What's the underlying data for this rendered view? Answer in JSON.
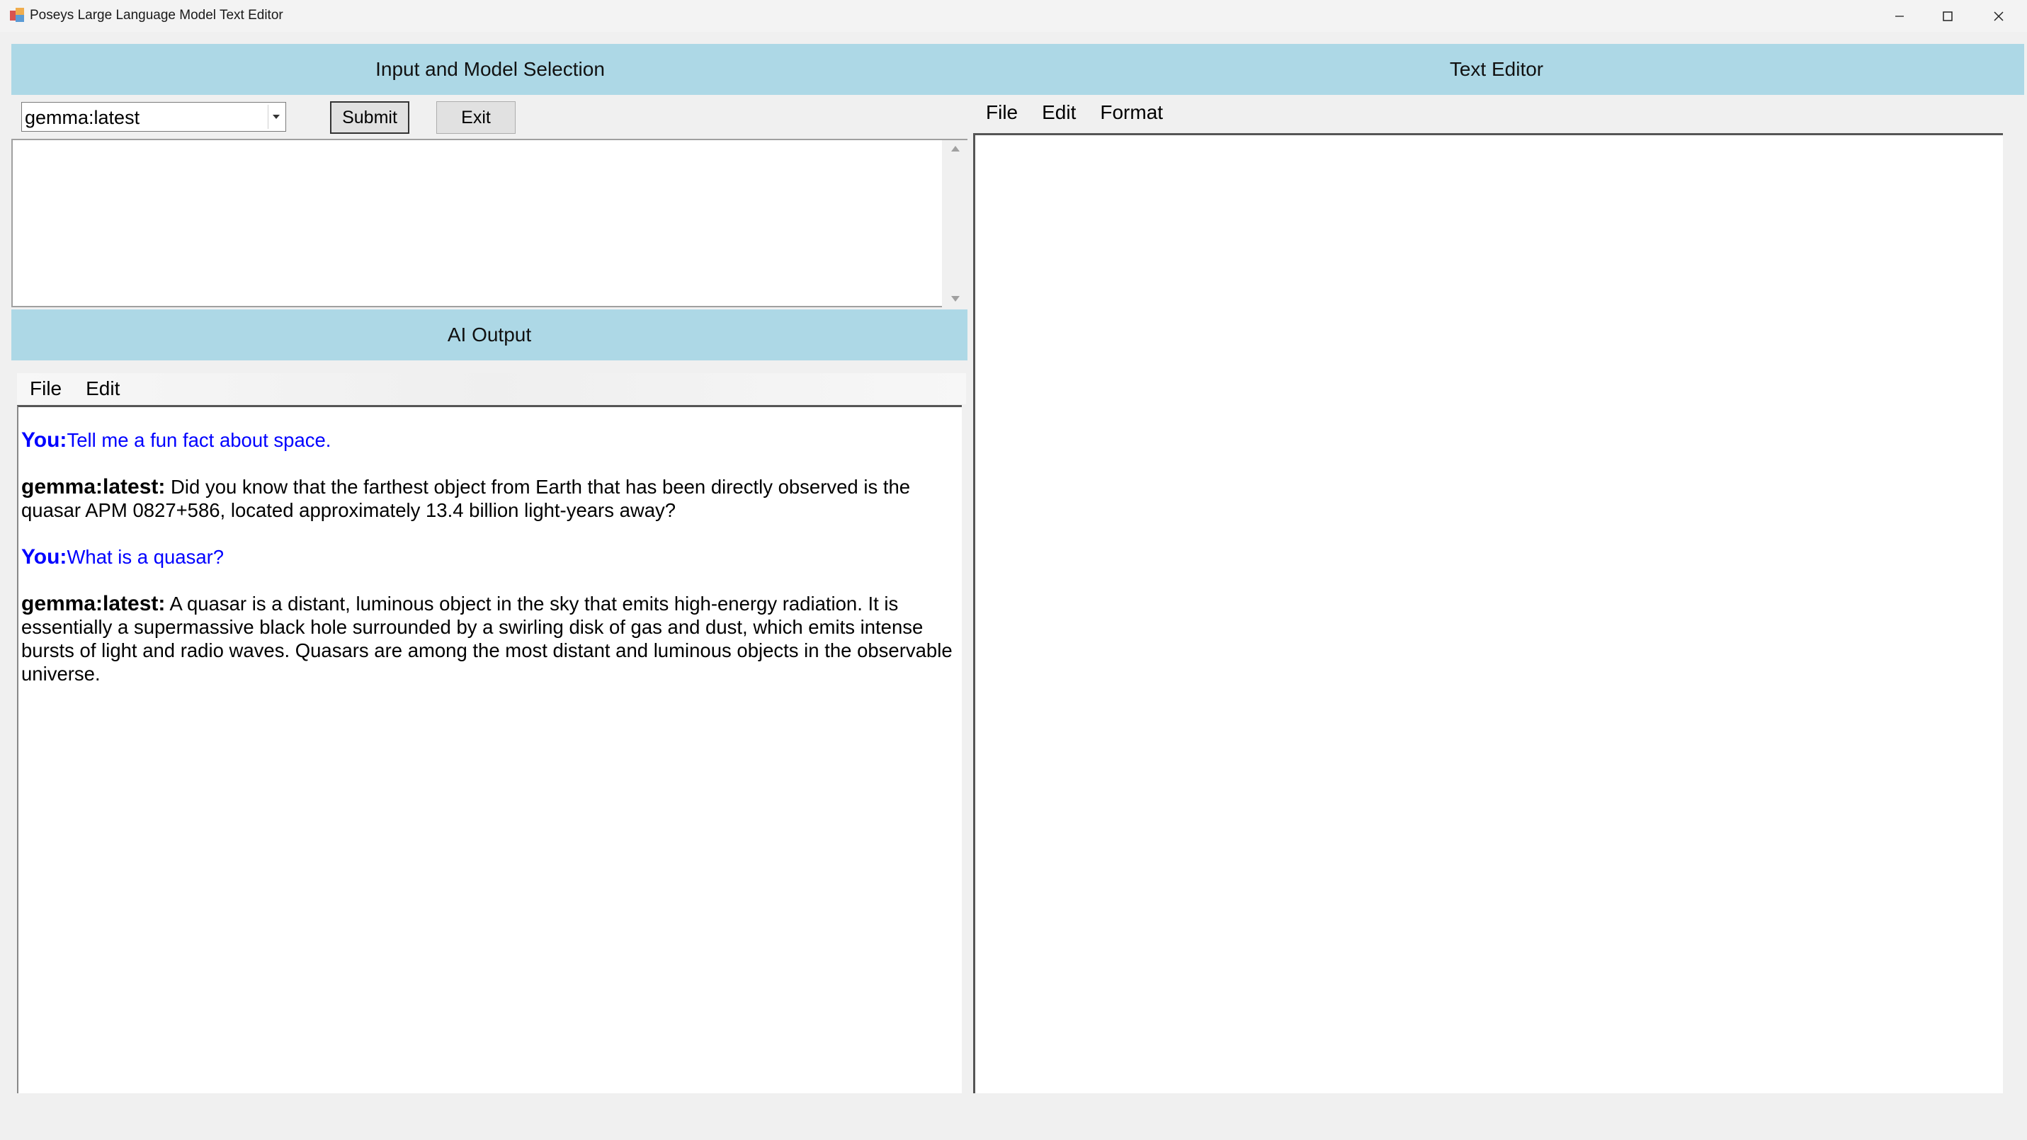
{
  "window": {
    "title": "Poseys Large Language Model Text Editor"
  },
  "headers": {
    "input": "Input and Model Selection",
    "editor": "Text Editor",
    "output": "AI Output"
  },
  "controls": {
    "model_selected": "gemma:latest",
    "submit_label": "Submit",
    "exit_label": "Exit",
    "prompt_value": ""
  },
  "ai_menu": {
    "file": "File",
    "edit": "Edit"
  },
  "editor_menu": {
    "file": "File",
    "edit": "Edit",
    "format": "Format"
  },
  "chat": [
    {
      "label": "You:",
      "text": "Tell me a fun fact about space."
    },
    {
      "label": "gemma:latest:",
      "text": "Did you know that the farthest object from Earth that has been directly observed is the quasar APM 0827+586, located approximately 13.4 billion light-years away?"
    },
    {
      "label": "You:",
      "text": "What is a quasar?"
    },
    {
      "label": "gemma:latest:",
      "text": "A quasar is a distant, luminous object in the sky that emits high-energy radiation. It is essentially a supermassive black hole surrounded by a swirling disk of gas and dust, which emits intense bursts of light and radio waves. Quasars are among the most distant and luminous objects in the observable universe."
    }
  ],
  "colors": {
    "header_bg": "#add8e6",
    "user_text": "#0000ff"
  },
  "icons": {
    "app": "app-icon",
    "minimize": "minimize-icon",
    "maximize": "maximize-icon",
    "close": "close-icon"
  }
}
